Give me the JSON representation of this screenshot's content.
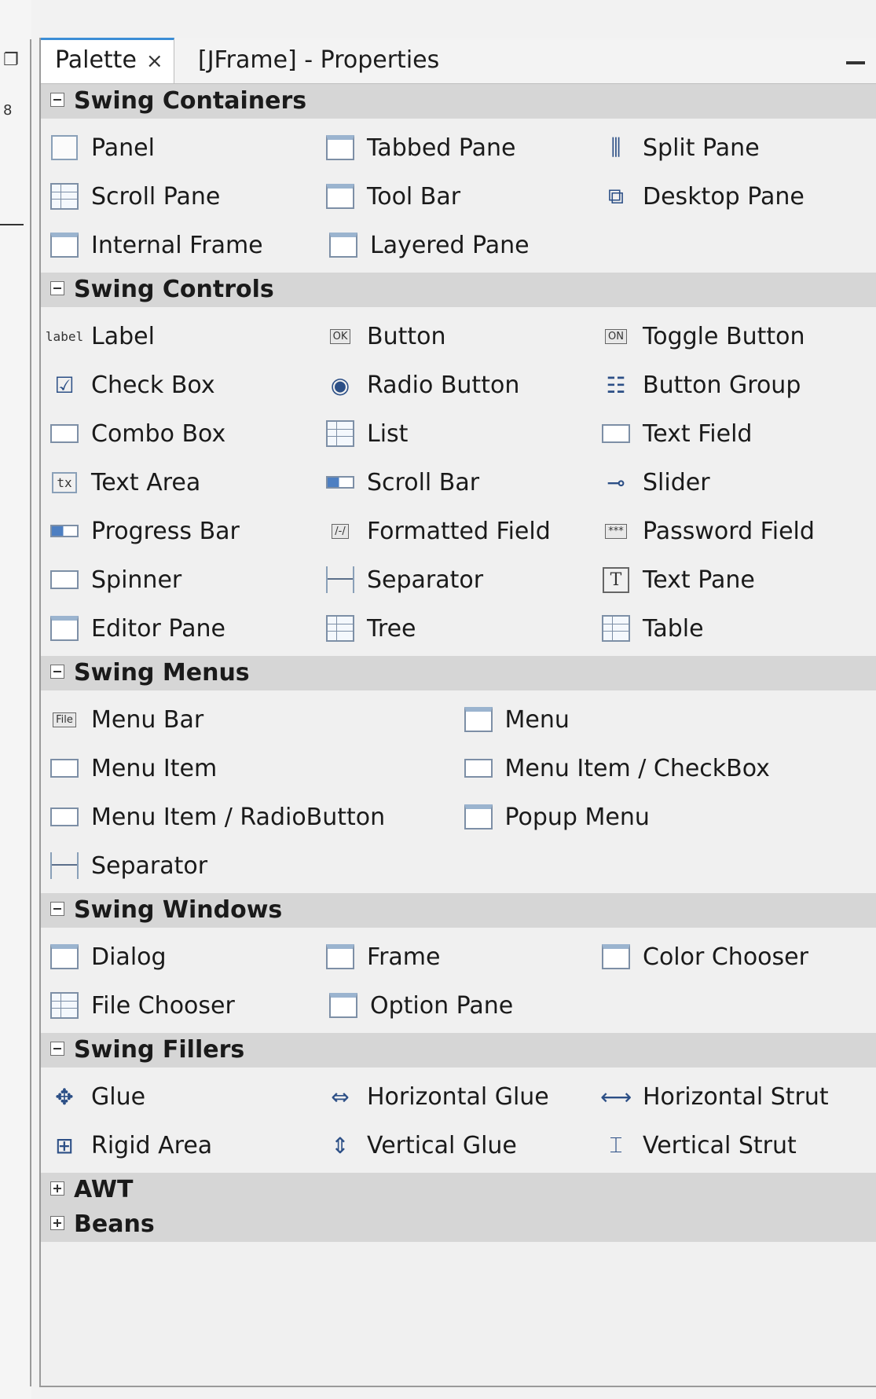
{
  "tabs": [
    {
      "label": "Palette",
      "active": true,
      "close_glyph": "×"
    },
    {
      "label": "[JFrame] - Properties",
      "active": false
    }
  ],
  "colors": {
    "tab_accent": "#3c8ed6",
    "category_bg": "#d6d6d6",
    "panel_bg": "#f0f0f0"
  },
  "categories": [
    {
      "label": "Swing Containers",
      "expanded": true,
      "columns": 3,
      "items": [
        {
          "label": "Panel",
          "icon": "panel-icon"
        },
        {
          "label": "Tabbed Pane",
          "icon": "tabbed-pane-icon"
        },
        {
          "label": "Split Pane",
          "icon": "split-pane-icon"
        },
        {
          "label": "Scroll Pane",
          "icon": "scroll-pane-icon"
        },
        {
          "label": "Tool Bar",
          "icon": "tool-bar-icon"
        },
        {
          "label": "Desktop Pane",
          "icon": "desktop-pane-icon"
        },
        {
          "label": "Internal Frame",
          "icon": "internal-frame-icon"
        },
        {
          "label": "Layered Pane",
          "icon": "layered-pane-icon"
        }
      ]
    },
    {
      "label": "Swing Controls",
      "expanded": true,
      "columns": 3,
      "items": [
        {
          "label": "Label",
          "icon": "label-icon",
          "icon_text": "label"
        },
        {
          "label": "Button",
          "icon": "button-icon",
          "icon_text": "OK"
        },
        {
          "label": "Toggle Button",
          "icon": "toggle-button-icon",
          "icon_text": "ON"
        },
        {
          "label": "Check Box",
          "icon": "check-box-icon"
        },
        {
          "label": "Radio Button",
          "icon": "radio-button-icon"
        },
        {
          "label": "Button Group",
          "icon": "button-group-icon"
        },
        {
          "label": "Combo Box",
          "icon": "combo-box-icon"
        },
        {
          "label": "List",
          "icon": "list-icon"
        },
        {
          "label": "Text Field",
          "icon": "text-field-icon"
        },
        {
          "label": "Text Area",
          "icon": "text-area-icon",
          "icon_text": "tx"
        },
        {
          "label": "Scroll Bar",
          "icon": "scroll-bar-icon"
        },
        {
          "label": "Slider",
          "icon": "slider-icon"
        },
        {
          "label": "Progress Bar",
          "icon": "progress-bar-icon"
        },
        {
          "label": "Formatted Field",
          "icon": "formatted-field-icon",
          "icon_text": "/-/"
        },
        {
          "label": "Password Field",
          "icon": "password-field-icon",
          "icon_text": "***"
        },
        {
          "label": "Spinner",
          "icon": "spinner-icon"
        },
        {
          "label": "Separator",
          "icon": "separator-icon"
        },
        {
          "label": "Text Pane",
          "icon": "text-pane-icon",
          "icon_text": "T"
        },
        {
          "label": "Editor Pane",
          "icon": "editor-pane-icon"
        },
        {
          "label": "Tree",
          "icon": "tree-icon"
        },
        {
          "label": "Table",
          "icon": "table-icon"
        }
      ]
    },
    {
      "label": "Swing Menus",
      "expanded": true,
      "columns": 2,
      "items": [
        {
          "label": "Menu Bar",
          "icon": "menu-bar-icon",
          "icon_text": "File"
        },
        {
          "label": "Menu",
          "icon": "menu-icon"
        },
        {
          "label": "Menu Item",
          "icon": "menu-item-icon"
        },
        {
          "label": "Menu Item / CheckBox",
          "icon": "menu-item-checkbox-icon"
        },
        {
          "label": "Menu Item / RadioButton",
          "icon": "menu-item-radiobutton-icon"
        },
        {
          "label": "Popup Menu",
          "icon": "popup-menu-icon"
        },
        {
          "label": "Separator",
          "icon": "menu-separator-icon"
        }
      ]
    },
    {
      "label": "Swing Windows",
      "expanded": true,
      "columns": 3,
      "items": [
        {
          "label": "Dialog",
          "icon": "dialog-icon"
        },
        {
          "label": "Frame",
          "icon": "frame-icon"
        },
        {
          "label": "Color Chooser",
          "icon": "color-chooser-icon"
        },
        {
          "label": "File Chooser",
          "icon": "file-chooser-icon"
        },
        {
          "label": "Option Pane",
          "icon": "option-pane-icon"
        }
      ]
    },
    {
      "label": "Swing Fillers",
      "expanded": true,
      "columns": 3,
      "items": [
        {
          "label": "Glue",
          "icon": "glue-icon"
        },
        {
          "label": "Horizontal Glue",
          "icon": "horizontal-glue-icon"
        },
        {
          "label": "Horizontal Strut",
          "icon": "horizontal-strut-icon"
        },
        {
          "label": "Rigid Area",
          "icon": "rigid-area-icon"
        },
        {
          "label": "Vertical Glue",
          "icon": "vertical-glue-icon"
        },
        {
          "label": "Vertical Strut",
          "icon": "vertical-strut-icon"
        }
      ]
    },
    {
      "label": "AWT",
      "expanded": false,
      "columns": 3,
      "items": []
    },
    {
      "label": "Beans",
      "expanded": false,
      "columns": 3,
      "items": []
    }
  ]
}
